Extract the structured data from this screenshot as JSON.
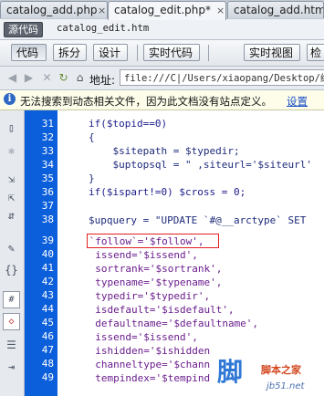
{
  "tabs": [
    {
      "label": "catalog_add.php",
      "close": "×"
    },
    {
      "label": "catalog_edit.php*",
      "close": "×"
    },
    {
      "label": "catalog_add.htm",
      "close": ""
    }
  ],
  "source_bar": {
    "source_code_label": "源代码",
    "file": "catalog_edit.htm"
  },
  "view_toolbar": {
    "code": "代码",
    "split": "拆分",
    "design": "设计",
    "live_code": "实时代码",
    "live_view": "实时视图",
    "inspect": "检"
  },
  "address_bar": {
    "label": "地址:",
    "value": "file:///C|/Users/xiaopang/Desktop/织梦"
  },
  "info_bar": {
    "message": "无法搜索到动态相关文件，因为此文档没有站点定义。",
    "link": "设置"
  },
  "gutter": {
    "line_numbers": [
      "31",
      "32",
      "33",
      "34",
      "35",
      "36",
      "37",
      "38",
      "39",
      "40",
      "41",
      "42",
      "43",
      "44",
      "45",
      "46",
      "47",
      "48",
      "49",
      "50"
    ]
  },
  "code": {
    "lines": [
      "if($topid==0)",
      "{",
      "    $sitepath = $typedir;",
      "    $uptopsql = \" ,siteurl='$siteurl'",
      "}",
      "if($ispart!=0) $cross = 0;",
      "",
      "$upquery = \"UPDATE `#@__arctype` SET",
      " `follow`='$follow',",
      "  issend='$issend',",
      "  sortrank='$sortrank',",
      "  typename='$typename',",
      "  typedir='$typedir',",
      "  isdefault='$isdefault',",
      "  defaultname='$defaultname',",
      "  issend='$issend',",
      "  ishidden='$ishidden",
      "  channeltype='$chann",
      "  tempindex='$tempind",
      ""
    ]
  },
  "watermark": {
    "logo": "脚",
    "title": "脚本之家",
    "site": "jb51.net"
  },
  "colors": {
    "gutter": "#0b5fdb",
    "highlight_box": "#e02020",
    "info_bg": "#fdfdea"
  },
  "icons": {
    "left_tools": [
      "document-icon",
      "asterisk-icon",
      "collapse-icon",
      "expand-icon",
      "select-parent-icon",
      "format-icon",
      "braces-icon",
      "comment-icon",
      "uncomment-icon",
      "wrap-icon",
      "indent-icon"
    ]
  }
}
